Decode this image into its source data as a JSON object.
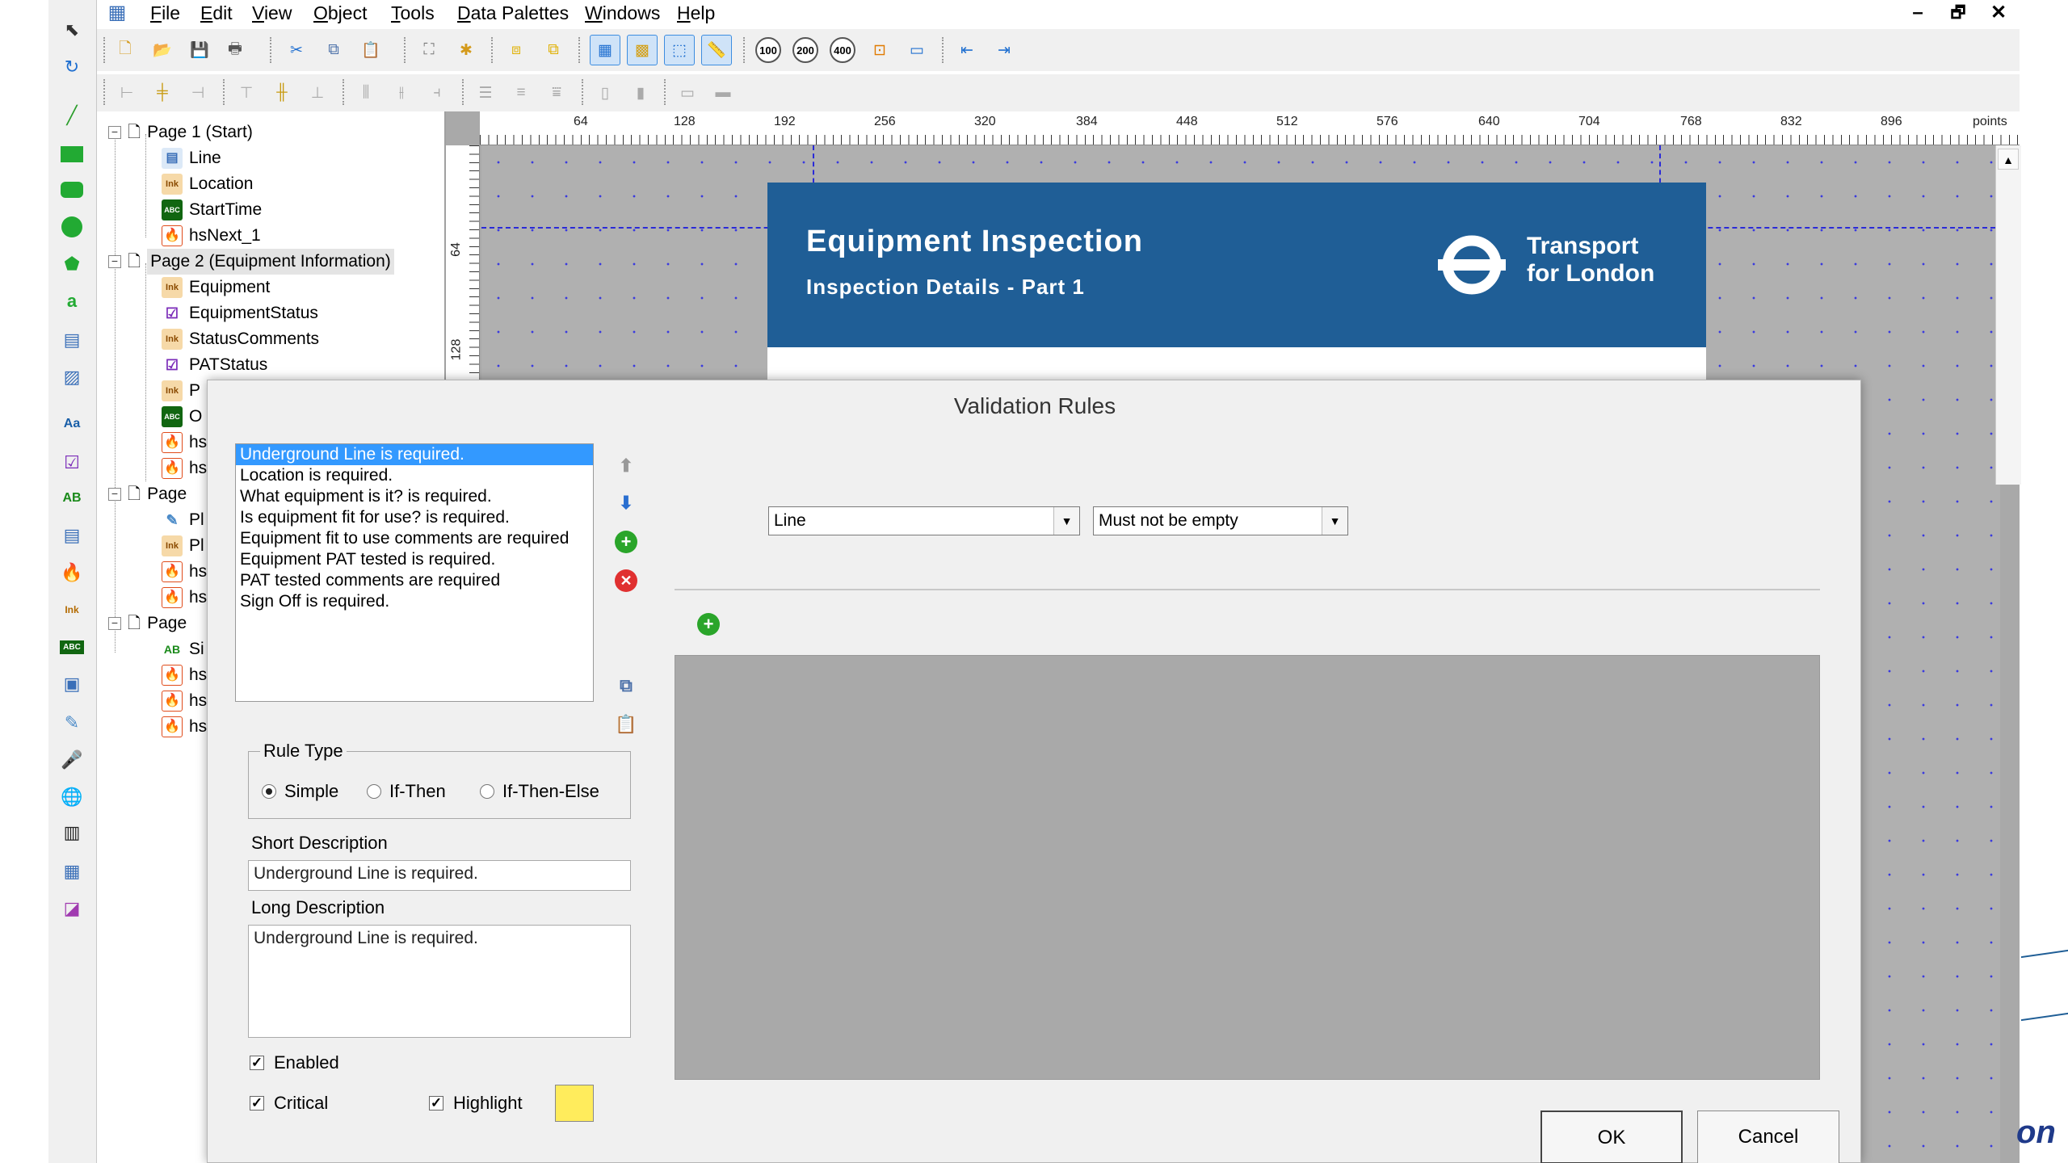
{
  "menu": [
    "File",
    "Edit",
    "View",
    "Object",
    "Tools",
    "Data Palettes",
    "Windows",
    "Help"
  ],
  "menu_mnemonics": [
    "F",
    "E",
    "V",
    "O",
    "T",
    "D",
    "W",
    "H"
  ],
  "window_controls": {
    "minimize": "–",
    "restore": "🗗",
    "close": "✕"
  },
  "toolbar": {
    "zoom_100": "100",
    "zoom_200": "200",
    "zoom_400": "400"
  },
  "tree": {
    "page1": "Page 1 (Start)",
    "page1_items": [
      "Line",
      "Location",
      "StartTime",
      "hsNext_1"
    ],
    "page2": "Page 2 (Equipment Information)",
    "page2_items": [
      "Equipment",
      "EquipmentStatus",
      "StatusComments",
      "PATStatus",
      "P",
      "O",
      "hs",
      "hs"
    ],
    "page3": "Page",
    "page3_items": [
      "Pl",
      "Pl",
      "hs",
      "hs"
    ],
    "page4": "Page",
    "page4_items": [
      "Si",
      "hs",
      "hs",
      "hs"
    ],
    "icon_labels": {
      "ink": "Ink",
      "abc": "ABC",
      "ab": "AB"
    }
  },
  "ruler": {
    "top": [
      "64",
      "128",
      "192",
      "256",
      "320",
      "384",
      "448",
      "512",
      "576",
      "640",
      "704",
      "768",
      "832",
      "896",
      "points"
    ],
    "left": [
      "64",
      "128"
    ]
  },
  "form_header": {
    "title": "Equipment Inspection",
    "subtitle": "Inspection Details - Part 1",
    "brand_line1": "Transport",
    "brand_line2": "for London"
  },
  "dialog": {
    "title": "Validation Rules",
    "rules": [
      "Underground Line is required.",
      "Location is required.",
      "What equipment is it? is required.",
      "Is equipment fit for use? is required.",
      "Equipment fit to use comments are required",
      "Equipment PAT tested is required.",
      "PAT tested comments are required",
      "Sign Off is required."
    ],
    "selected_rule_index": 0,
    "rule_type": {
      "legend": "Rule Type",
      "options": [
        "Simple",
        "If-Then",
        "If-Then-Else"
      ],
      "selected": "Simple"
    },
    "short_description_label": "Short Description",
    "short_description_value": "Underground Line is required.",
    "long_description_label": "Long Description",
    "long_description_value": "Underground Line is required.",
    "enabled_label": "Enabled",
    "enabled": true,
    "critical_label": "Critical",
    "critical": true,
    "highlight_label": "Highlight",
    "highlight": true,
    "highlight_color": "#ffec5c",
    "field_select": "Line",
    "condition_select": "Must not be empty",
    "ok_label": "OK",
    "cancel_label": "Cancel"
  },
  "colors": {
    "header_blue": "#1f5e96",
    "selection_blue": "#3399ff",
    "grid_dot": "#3a3adf"
  },
  "bottom_right_fragment": "on"
}
